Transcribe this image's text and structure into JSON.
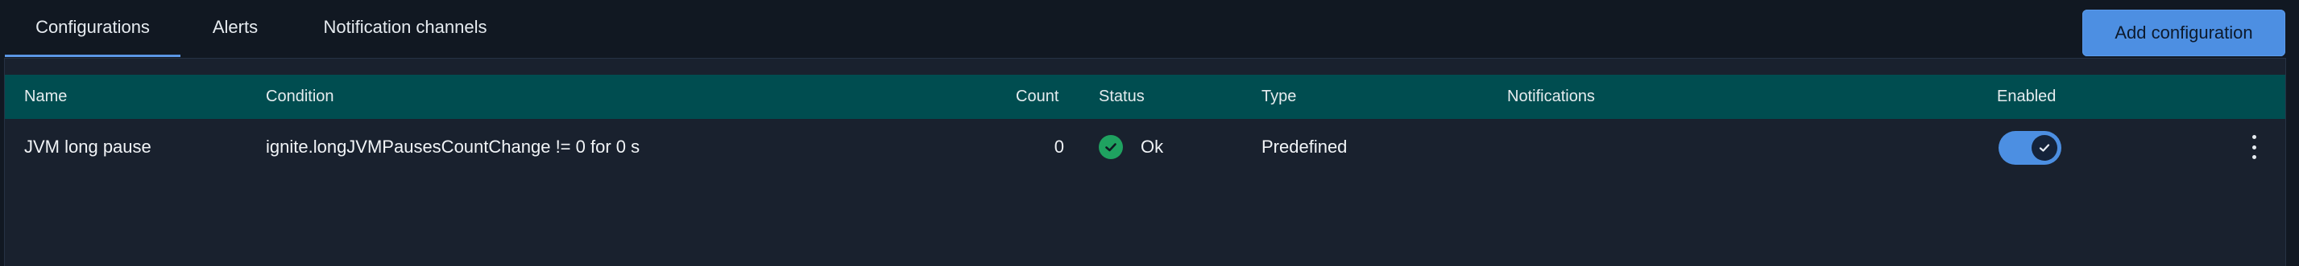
{
  "tabs": [
    {
      "label": "Configurations",
      "active": true
    },
    {
      "label": "Alerts",
      "active": false
    },
    {
      "label": "Notification channels",
      "active": false
    }
  ],
  "actions": {
    "add_configuration_label": "Add configuration"
  },
  "table": {
    "columns": {
      "name": "Name",
      "condition": "Condition",
      "count": "Count",
      "status": "Status",
      "type": "Type",
      "notifications": "Notifications",
      "enabled": "Enabled"
    },
    "rows": [
      {
        "name": "JVM long pause",
        "condition": "ignite.longJVMPausesCountChange != 0 for 0 s",
        "count": "0",
        "status": "Ok",
        "status_icon": "check-circle-icon",
        "type": "Predefined",
        "notifications": "",
        "enabled": true
      }
    ]
  },
  "colors": {
    "accent": "#4d8fe2",
    "header_bg": "#004d50",
    "status_ok": "#1fa260",
    "page_bg": "#111822",
    "panel_bg": "#19212e"
  }
}
